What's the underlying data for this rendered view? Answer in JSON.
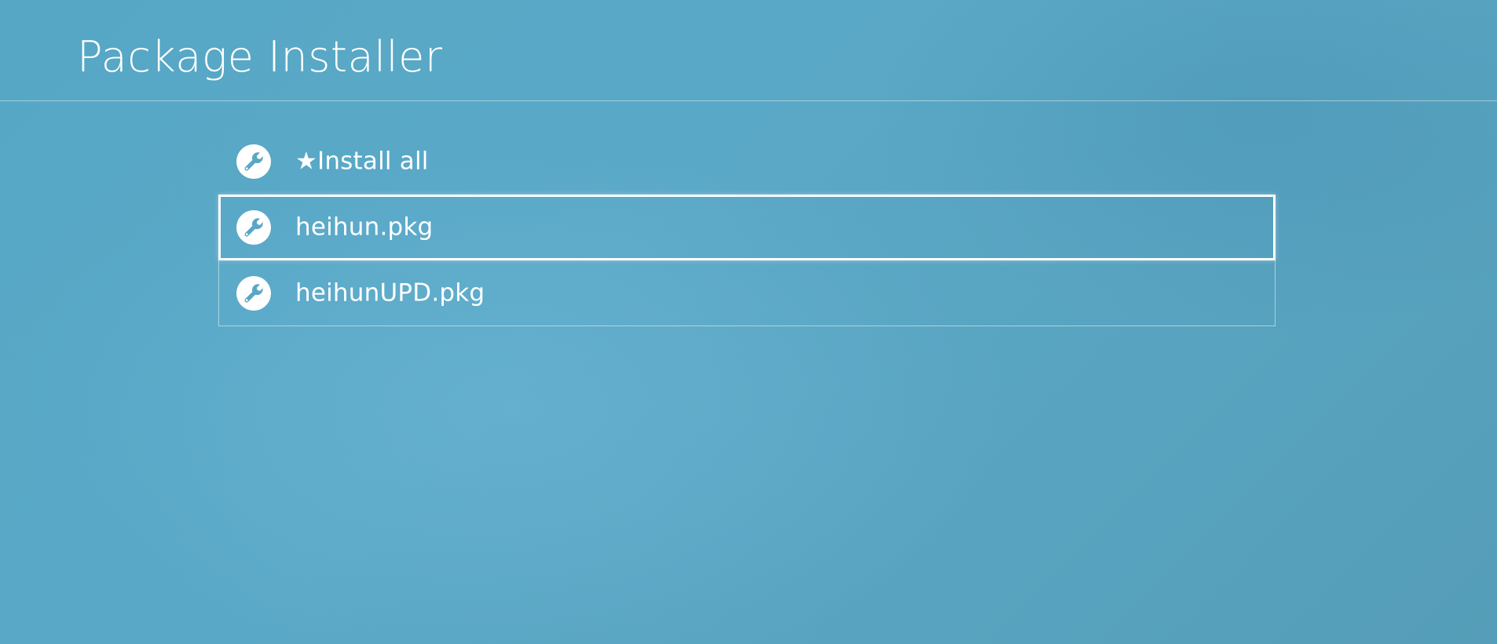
{
  "header": {
    "title": "Package Installer"
  },
  "list": {
    "items": [
      {
        "label": "★Install all",
        "icon": "wrench-icon",
        "state": "normal"
      },
      {
        "label": "heihun.pkg",
        "icon": "wrench-icon",
        "state": "focused"
      },
      {
        "label": "heihunUPD.pkg",
        "icon": "wrench-icon",
        "state": "normal"
      }
    ]
  },
  "colors": {
    "background": "#58a6c4",
    "text": "#ffffff",
    "icon_bg": "#ffffff",
    "icon_fg": "#5aa7c5"
  }
}
